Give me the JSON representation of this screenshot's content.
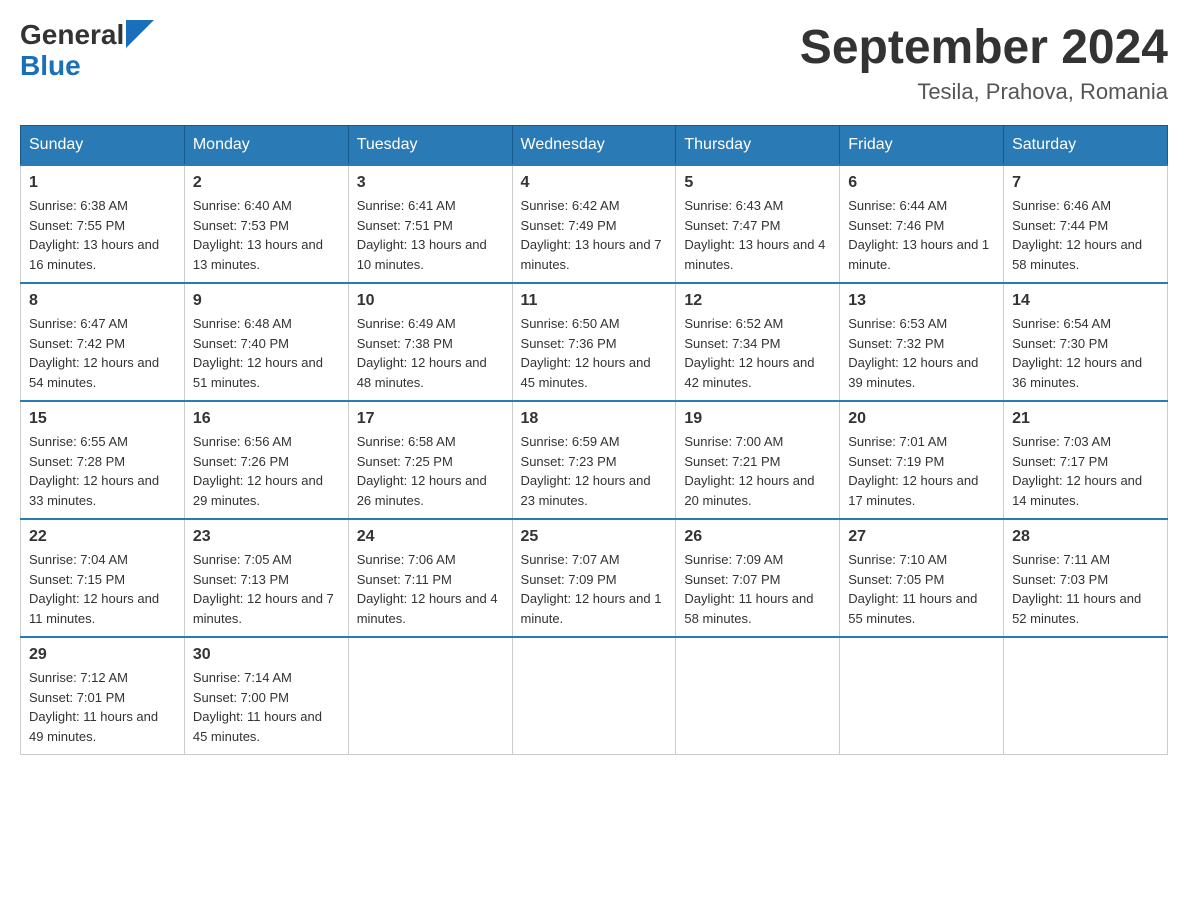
{
  "header": {
    "logo_general": "General",
    "logo_blue": "Blue",
    "month": "September 2024",
    "location": "Tesila, Prahova, Romania"
  },
  "weekdays": [
    "Sunday",
    "Monday",
    "Tuesday",
    "Wednesday",
    "Thursday",
    "Friday",
    "Saturday"
  ],
  "weeks": [
    [
      {
        "day": "1",
        "sunrise": "6:38 AM",
        "sunset": "7:55 PM",
        "daylight": "13 hours and 16 minutes."
      },
      {
        "day": "2",
        "sunrise": "6:40 AM",
        "sunset": "7:53 PM",
        "daylight": "13 hours and 13 minutes."
      },
      {
        "day": "3",
        "sunrise": "6:41 AM",
        "sunset": "7:51 PM",
        "daylight": "13 hours and 10 minutes."
      },
      {
        "day": "4",
        "sunrise": "6:42 AM",
        "sunset": "7:49 PM",
        "daylight": "13 hours and 7 minutes."
      },
      {
        "day": "5",
        "sunrise": "6:43 AM",
        "sunset": "7:47 PM",
        "daylight": "13 hours and 4 minutes."
      },
      {
        "day": "6",
        "sunrise": "6:44 AM",
        "sunset": "7:46 PM",
        "daylight": "13 hours and 1 minute."
      },
      {
        "day": "7",
        "sunrise": "6:46 AM",
        "sunset": "7:44 PM",
        "daylight": "12 hours and 58 minutes."
      }
    ],
    [
      {
        "day": "8",
        "sunrise": "6:47 AM",
        "sunset": "7:42 PM",
        "daylight": "12 hours and 54 minutes."
      },
      {
        "day": "9",
        "sunrise": "6:48 AM",
        "sunset": "7:40 PM",
        "daylight": "12 hours and 51 minutes."
      },
      {
        "day": "10",
        "sunrise": "6:49 AM",
        "sunset": "7:38 PM",
        "daylight": "12 hours and 48 minutes."
      },
      {
        "day": "11",
        "sunrise": "6:50 AM",
        "sunset": "7:36 PM",
        "daylight": "12 hours and 45 minutes."
      },
      {
        "day": "12",
        "sunrise": "6:52 AM",
        "sunset": "7:34 PM",
        "daylight": "12 hours and 42 minutes."
      },
      {
        "day": "13",
        "sunrise": "6:53 AM",
        "sunset": "7:32 PM",
        "daylight": "12 hours and 39 minutes."
      },
      {
        "day": "14",
        "sunrise": "6:54 AM",
        "sunset": "7:30 PM",
        "daylight": "12 hours and 36 minutes."
      }
    ],
    [
      {
        "day": "15",
        "sunrise": "6:55 AM",
        "sunset": "7:28 PM",
        "daylight": "12 hours and 33 minutes."
      },
      {
        "day": "16",
        "sunrise": "6:56 AM",
        "sunset": "7:26 PM",
        "daylight": "12 hours and 29 minutes."
      },
      {
        "day": "17",
        "sunrise": "6:58 AM",
        "sunset": "7:25 PM",
        "daylight": "12 hours and 26 minutes."
      },
      {
        "day": "18",
        "sunrise": "6:59 AM",
        "sunset": "7:23 PM",
        "daylight": "12 hours and 23 minutes."
      },
      {
        "day": "19",
        "sunrise": "7:00 AM",
        "sunset": "7:21 PM",
        "daylight": "12 hours and 20 minutes."
      },
      {
        "day": "20",
        "sunrise": "7:01 AM",
        "sunset": "7:19 PM",
        "daylight": "12 hours and 17 minutes."
      },
      {
        "day": "21",
        "sunrise": "7:03 AM",
        "sunset": "7:17 PM",
        "daylight": "12 hours and 14 minutes."
      }
    ],
    [
      {
        "day": "22",
        "sunrise": "7:04 AM",
        "sunset": "7:15 PM",
        "daylight": "12 hours and 11 minutes."
      },
      {
        "day": "23",
        "sunrise": "7:05 AM",
        "sunset": "7:13 PM",
        "daylight": "12 hours and 7 minutes."
      },
      {
        "day": "24",
        "sunrise": "7:06 AM",
        "sunset": "7:11 PM",
        "daylight": "12 hours and 4 minutes."
      },
      {
        "day": "25",
        "sunrise": "7:07 AM",
        "sunset": "7:09 PM",
        "daylight": "12 hours and 1 minute."
      },
      {
        "day": "26",
        "sunrise": "7:09 AM",
        "sunset": "7:07 PM",
        "daylight": "11 hours and 58 minutes."
      },
      {
        "day": "27",
        "sunrise": "7:10 AM",
        "sunset": "7:05 PM",
        "daylight": "11 hours and 55 minutes."
      },
      {
        "day": "28",
        "sunrise": "7:11 AM",
        "sunset": "7:03 PM",
        "daylight": "11 hours and 52 minutes."
      }
    ],
    [
      {
        "day": "29",
        "sunrise": "7:12 AM",
        "sunset": "7:01 PM",
        "daylight": "11 hours and 49 minutes."
      },
      {
        "day": "30",
        "sunrise": "7:14 AM",
        "sunset": "7:00 PM",
        "daylight": "11 hours and 45 minutes."
      },
      null,
      null,
      null,
      null,
      null
    ]
  ]
}
